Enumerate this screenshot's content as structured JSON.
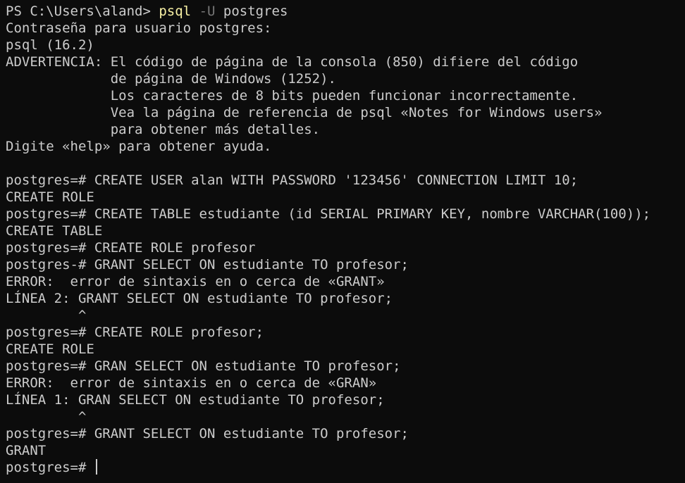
{
  "terminal": {
    "colors": {
      "background": "#0c0c0c",
      "text": "#cccccc",
      "command": "#f9f1a5",
      "parameter": "#767676"
    },
    "ps_prompt": "PS C:\\Users\\aland> ",
    "ps_command": "psql",
    "ps_flag": "-U",
    "ps_arg": "postgres",
    "lines": [
      "Contraseña para usuario postgres:",
      "psql (16.2)",
      "ADVERTENCIA: El código de página de la consola (850) difiere del código",
      "             de página de Windows (1252).",
      "             Los caracteres de 8 bits pueden funcionar incorrectamente.",
      "             Vea la página de referencia de psql «Notes for Windows users»",
      "             para obtener más detalles.",
      "Digite «help» para obtener ayuda.",
      "",
      "postgres=# CREATE USER alan WITH PASSWORD '123456' CONNECTION LIMIT 10;",
      "CREATE ROLE",
      "postgres=# CREATE TABLE estudiante (id SERIAL PRIMARY KEY, nombre VARCHAR(100));",
      "CREATE TABLE",
      "postgres=# CREATE ROLE profesor",
      "postgres-# GRANT SELECT ON estudiante TO profesor;",
      "ERROR:  error de sintaxis en o cerca de «GRANT»",
      "LÍNEA 2: GRANT SELECT ON estudiante TO profesor;",
      "         ^",
      "postgres=# CREATE ROLE profesor;",
      "CREATE ROLE",
      "postgres=# GRAN SELECT ON estudiante TO profesor;",
      "ERROR:  error de sintaxis en o cerca de «GRAN»",
      "LÍNEA 1: GRAN SELECT ON estudiante TO profesor;",
      "         ^",
      "postgres=# GRANT SELECT ON estudiante TO profesor;",
      "GRANT"
    ],
    "current_prompt": "postgres=# "
  }
}
